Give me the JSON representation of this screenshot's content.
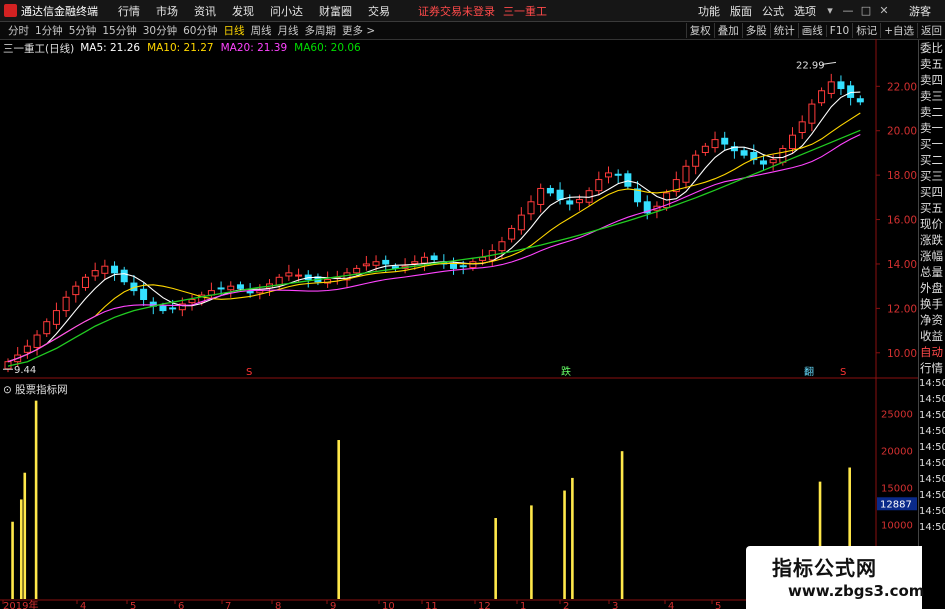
{
  "app": {
    "title": "通达信金融终端",
    "menus": [
      "行情",
      "市场",
      "资讯",
      "发现",
      "问小达",
      "财富圈",
      "交易"
    ],
    "login_status": "证券交易未登录",
    "stock_name": "三一重工",
    "right_menus": [
      "功能",
      "版面",
      "公式",
      "选项"
    ],
    "window_buttons": [
      "▾",
      "—",
      "□",
      "✕"
    ],
    "guest": "游客"
  },
  "toolbar": {
    "periods": [
      "分时",
      "1分钟",
      "5分钟",
      "15分钟",
      "30分钟",
      "60分钟",
      "日线",
      "周线",
      "月线",
      "多周期",
      "更多 >"
    ],
    "active_period": "日线",
    "right_buttons": [
      "复权",
      "叠加",
      "多股",
      "统计",
      "画线",
      "F10",
      "标记",
      "+自选",
      "返回"
    ]
  },
  "info": {
    "chart_title": "三一重工(日线)",
    "ma": [
      {
        "label": "MA5: 21.26",
        "color": "#ffffff"
      },
      {
        "label": "MA10: 21.27",
        "color": "#ffd700"
      },
      {
        "label": "MA20: 21.39",
        "color": "#ff44ff"
      },
      {
        "label": "MA60: 20.06",
        "color": "#00dd00"
      }
    ]
  },
  "side_panel": {
    "items": [
      "委比",
      "卖五",
      "卖四",
      "卖三",
      "卖二",
      "卖一",
      "买一",
      "买二",
      "买三",
      "买四",
      "买五",
      "现价",
      "涨跌",
      "涨幅",
      "总量",
      "外盘",
      "换手",
      "净资",
      "收益",
      "自动",
      "行情"
    ],
    "times": [
      "14:50",
      "14:50",
      "14:50",
      "14:50",
      "14:50",
      "14:50",
      "14:50",
      "14:50",
      "14:50",
      "14:50"
    ]
  },
  "price_axis": {
    "ticks": [
      "22.00",
      "20.00",
      "18.00",
      "16.00",
      "14.00",
      "12.00",
      "10.00"
    ]
  },
  "volume_axis": {
    "ticks": [
      "25000",
      "20000",
      "15000",
      "10000"
    ],
    "current_value": "12887"
  },
  "annotations": {
    "high": "22.99",
    "low": "9.44"
  },
  "signals": [
    {
      "label": "S",
      "color": "#ff3333"
    },
    {
      "label": "跌",
      "color": "#66ff66"
    },
    {
      "label": "翻",
      "color": "#66ddff"
    },
    {
      "label": "S",
      "color": "#ff3333"
    }
  ],
  "indicator": {
    "title": "股票指标网"
  },
  "x_axis": {
    "labels": [
      "2019年",
      "4",
      "5",
      "6",
      "7",
      "8",
      "9",
      "10",
      "11",
      "12",
      "1",
      "2",
      "3",
      "4",
      "5",
      "6"
    ]
  },
  "watermark": {
    "line1": "指标公式网",
    "line2": "www.zbgs3.com"
  },
  "chart_data": {
    "type": "candlestick",
    "ylim": [
      9.0,
      23.5
    ],
    "close": [
      9.6,
      9.9,
      10.3,
      10.8,
      11.4,
      11.9,
      12.5,
      13.0,
      13.4,
      13.7,
      13.9,
      13.6,
      13.2,
      12.8,
      12.4,
      12.1,
      11.9,
      12.0,
      12.2,
      12.4,
      12.6,
      12.8,
      12.9,
      13.0,
      12.9,
      12.7,
      12.8,
      13.1,
      13.4,
      13.6,
      13.5,
      13.3,
      13.2,
      13.3,
      13.4,
      13.6,
      13.8,
      14.0,
      14.1,
      14.0,
      13.8,
      13.9,
      14.1,
      14.3,
      14.2,
      14.0,
      13.8,
      13.9,
      14.1,
      14.3,
      14.6,
      15.0,
      15.6,
      16.2,
      16.8,
      17.4,
      17.2,
      16.9,
      16.7,
      16.9,
      17.3,
      17.8,
      18.1,
      18.0,
      17.5,
      16.8,
      16.3,
      16.6,
      17.2,
      17.8,
      18.4,
      18.9,
      19.3,
      19.6,
      19.4,
      19.1,
      18.9,
      18.7,
      18.5,
      18.7,
      19.2,
      19.8,
      20.4,
      21.2,
      21.8,
      22.2,
      21.9,
      21.5,
      21.3
    ],
    "ma60": [
      9.4,
      9.5,
      9.6,
      9.8,
      10.0,
      10.2,
      10.45,
      10.7,
      10.95,
      11.2,
      11.4,
      11.6,
      11.75,
      11.9,
      12.0,
      12.1,
      12.2,
      12.28,
      12.36,
      12.44,
      12.52,
      12.6,
      12.67,
      12.74,
      12.81,
      12.88,
      12.95,
      13.0,
      13.06,
      13.12,
      13.18,
      13.24,
      13.3,
      13.36,
      13.42,
      13.48,
      13.54,
      13.6,
      13.66,
      13.72,
      13.78,
      13.84,
      13.9,
      13.96,
      14.02,
      14.08,
      14.14,
      14.2,
      14.26,
      14.32,
      14.4,
      14.48,
      14.56,
      14.65,
      14.75,
      14.85,
      14.96,
      15.07,
      15.18,
      15.3,
      15.42,
      15.55,
      15.68,
      15.81,
      15.94,
      16.08,
      16.22,
      16.36,
      16.5,
      16.66,
      16.82,
      16.98,
      17.15,
      17.32,
      17.5,
      17.68,
      17.86,
      18.04,
      18.22,
      18.4,
      18.58,
      18.76,
      18.94,
      19.12,
      19.3,
      19.48,
      19.66,
      19.84,
      20.02
    ],
    "volume_bars": [
      {
        "x": 0.012,
        "value": 10400
      },
      {
        "x": 0.022,
        "value": 13400
      },
      {
        "x": 0.026,
        "value": 17000
      },
      {
        "x": 0.039,
        "value": 26700
      },
      {
        "x": 0.386,
        "value": 21400
      },
      {
        "x": 0.566,
        "value": 10900
      },
      {
        "x": 0.607,
        "value": 12600
      },
      {
        "x": 0.645,
        "value": 14600
      },
      {
        "x": 0.654,
        "value": 16300
      },
      {
        "x": 0.711,
        "value": 19900
      },
      {
        "x": 0.938,
        "value": 15800
      },
      {
        "x": 0.972,
        "value": 17700
      }
    ],
    "volume_ylim": [
      0,
      28000
    ]
  }
}
